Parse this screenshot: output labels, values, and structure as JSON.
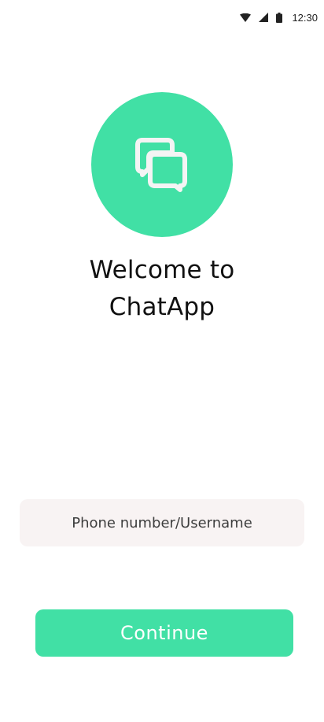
{
  "status_bar": {
    "time": "12:30",
    "icons": [
      "wifi-icon",
      "cellular-signal-icon",
      "battery-icon"
    ]
  },
  "logo": {
    "icon": "chat-bubbles-icon",
    "background_color": "#41e0a5"
  },
  "welcome": {
    "line1": "Welcome to",
    "line2": "ChatApp"
  },
  "login_input": {
    "placeholder": "Phone number/Username",
    "value": ""
  },
  "continue_button": {
    "label": "Continue",
    "color": "#41e0a5"
  }
}
